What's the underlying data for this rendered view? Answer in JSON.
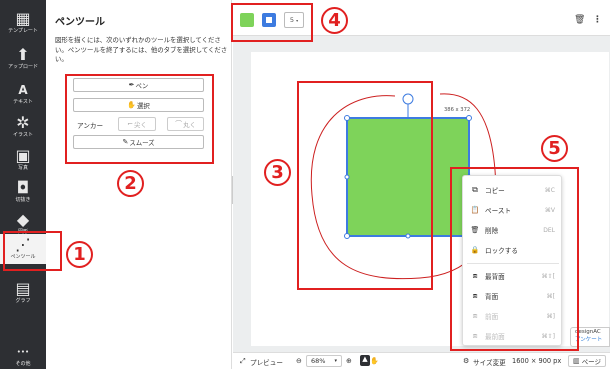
{
  "sidebar": {
    "items": [
      {
        "label": "テンプレート",
        "icon": "template-icon",
        "glyph": "▦"
      },
      {
        "label": "アップロード",
        "icon": "upload-file-icon",
        "glyph": "⬆"
      },
      {
        "label": "テキスト",
        "icon": "text-icon",
        "glyph": "A"
      },
      {
        "label": "イラスト",
        "icon": "illustration-icon",
        "glyph": "✲"
      },
      {
        "label": "写真",
        "icon": "photo-icon",
        "glyph": "▣"
      },
      {
        "label": "切抜き",
        "icon": "crop-icon",
        "glyph": "◘"
      },
      {
        "label": "図形",
        "icon": "shapes-icon",
        "glyph": "◆"
      },
      {
        "label": "ペンツール",
        "icon": "pen-tool-icon",
        "glyph": "⋰"
      },
      {
        "label": "グラフ",
        "icon": "graph-icon",
        "glyph": "▤"
      },
      {
        "label": "その他",
        "icon": "more-icon",
        "glyph": "•••"
      }
    ]
  },
  "panel": {
    "title": "ペンツール",
    "description": "図形を描くには、次のいずれかのツールを選択してください。ペンツールを終了するには、他のタブを選択してください。",
    "pen_button": "ペン",
    "select_button": "選択",
    "anchor_label": "アンカー",
    "anchor_corner_button": "尖く",
    "anchor_round_button": "丸く",
    "smooth_button": "スムーズ"
  },
  "toolbar": {
    "fill_color": "#7ed35a",
    "stroke_color": "#3d7be0",
    "stroke_width": "5"
  },
  "canvas": {
    "size_label": "386 x 372"
  },
  "context_menu": {
    "items": [
      {
        "label": "コピー",
        "shortcut": "⌘C",
        "icon": "copy-icon",
        "glyph": "⧉",
        "disabled": false
      },
      {
        "label": "ペースト",
        "shortcut": "⌘V",
        "icon": "paste-icon",
        "glyph": "📋",
        "disabled": false
      },
      {
        "label": "削除",
        "shortcut": "DEL",
        "icon": "trash-icon",
        "glyph": "🗑",
        "disabled": false
      },
      {
        "label": "ロックする",
        "shortcut": "",
        "icon": "lock-icon",
        "glyph": "🔒",
        "disabled": false
      },
      {
        "label": "最背面",
        "shortcut": "⌘⇧[",
        "icon": "send-to-back-icon",
        "glyph": "⧈",
        "disabled": false
      },
      {
        "label": "背面",
        "shortcut": "⌘[",
        "icon": "send-backward-icon",
        "glyph": "⧈",
        "disabled": false
      },
      {
        "label": "前面",
        "shortcut": "⌘]",
        "icon": "bring-forward-icon",
        "glyph": "⧈",
        "disabled": true
      },
      {
        "label": "最前面",
        "shortcut": "⌘⇧]",
        "icon": "bring-to-front-icon",
        "glyph": "⧈",
        "disabled": true
      }
    ]
  },
  "badge": {
    "line1": "designAC",
    "line2": "アンケート"
  },
  "bottombar": {
    "preview": "プレビュー",
    "zoom": "68%",
    "resize": "サイズ変更",
    "dimensions": "1600 × 900 px",
    "page": "ページ"
  },
  "annotations": {
    "n1": "1",
    "n2": "2",
    "n3": "3",
    "n4": "4",
    "n5": "5",
    "color": "#e12020"
  }
}
